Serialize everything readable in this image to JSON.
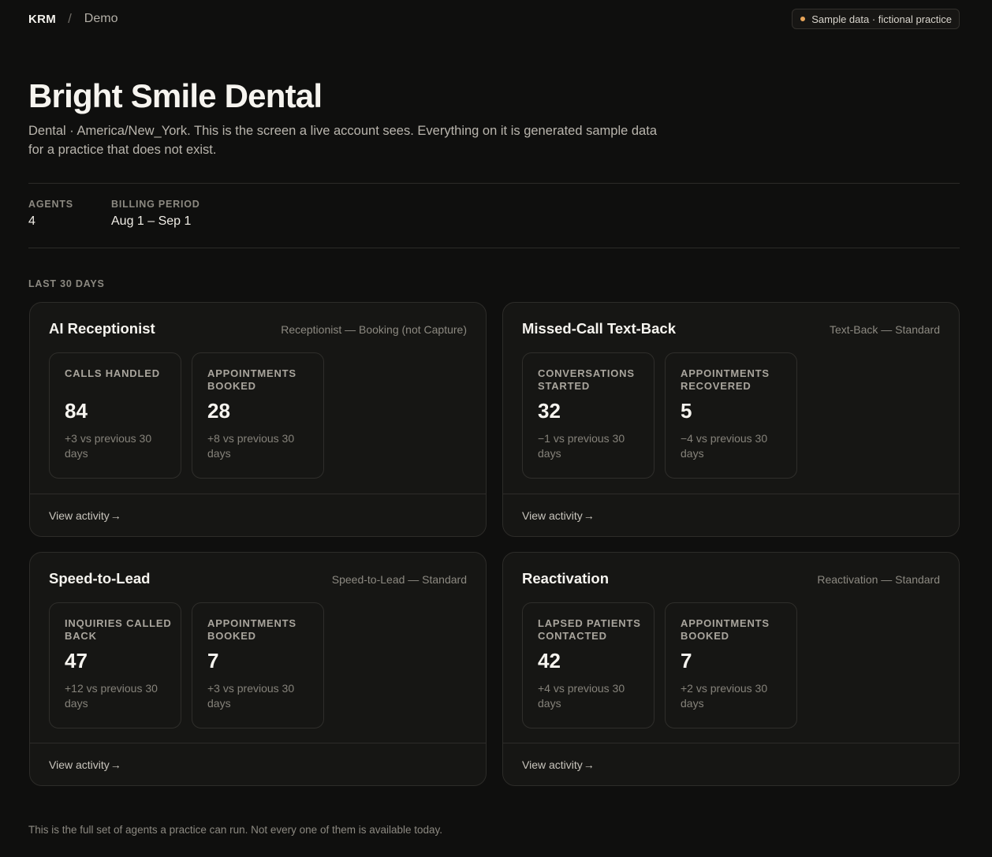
{
  "topbar": {
    "brand": "KRM",
    "separator": "/",
    "crumb": "Demo",
    "badge_text": "Sample data · fictional practice",
    "badge_dot_color": "#e8a55a"
  },
  "page": {
    "title": "Bright Smile Dental",
    "subtitle": "Dental · America/New_York. This is the screen a live account sees. Everything on it is generated sample data for a practice that does not exist."
  },
  "stats": {
    "agents_label": "AGENTS",
    "agents_value": "4",
    "billing_label": "BILLING PERIOD",
    "billing_value": "Aug 1 – Sep 1"
  },
  "section_label": "LAST 30 DAYS",
  "cards": [
    {
      "title": "AI Receptionist",
      "plan": "Receptionist — Booking (not Capture)",
      "tiles": [
        {
          "label": "CALLS HANDLED",
          "value": "84",
          "delta": "+3 vs previous 30 days"
        },
        {
          "label": "APPOINTMENTS BOOKED",
          "value": "28",
          "delta": "+8 vs previous 30 days"
        }
      ],
      "link": "View activity",
      "arrow": "→"
    },
    {
      "title": "Missed-Call Text-Back",
      "plan": "Text-Back — Standard",
      "tiles": [
        {
          "label": "CONVERSATIONS STARTED",
          "value": "32",
          "delta": "−1 vs previous 30 days"
        },
        {
          "label": "APPOINTMENTS RECOVERED",
          "value": "5",
          "delta": "−4 vs previous 30 days"
        }
      ],
      "link": "View activity",
      "arrow": "→"
    },
    {
      "title": "Speed-to-Lead",
      "plan": "Speed-to-Lead — Standard",
      "tiles": [
        {
          "label": "INQUIRIES CALLED BACK",
          "value": "47",
          "delta": "+12 vs previous 30 days"
        },
        {
          "label": "APPOINTMENTS BOOKED",
          "value": "7",
          "delta": "+3 vs previous 30 days"
        }
      ],
      "link": "View activity",
      "arrow": "→"
    },
    {
      "title": "Reactivation",
      "plan": "Reactivation — Standard",
      "tiles": [
        {
          "label": "LAPSED PATIENTS CONTACTED",
          "value": "42",
          "delta": "+4 vs previous 30 days"
        },
        {
          "label": "APPOINTMENTS BOOKED",
          "value": "7",
          "delta": "+2 vs previous 30 days"
        }
      ],
      "link": "View activity",
      "arrow": "→"
    }
  ],
  "footer_note": "This is the full set of agents a practice can run. Not every one of them is available today."
}
